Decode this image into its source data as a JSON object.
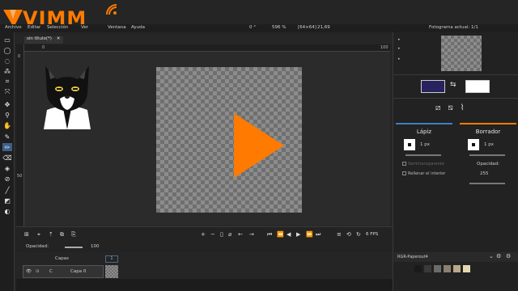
{
  "logo": {
    "text": "VIMM",
    "brand_color": "#ff7a00"
  },
  "menu": {
    "items": [
      "Archivo",
      "Editar",
      "Selección",
      "Ver",
      "Ventana",
      "Ayuda"
    ]
  },
  "status": {
    "rotation": "0 °",
    "zoom": "596 %",
    "canvas_size": "[64×64]",
    "cursor": "21,69"
  },
  "frames_header": {
    "label": "Fotograma actual:",
    "value": "1/1"
  },
  "tab": {
    "title": "sin título(*)",
    "close": "✕"
  },
  "ruler": {
    "top_start": "0",
    "top_end": "100",
    "left_mark": "0",
    "left_mid": "50"
  },
  "timeline": {
    "fps": "6 FPS"
  },
  "layer_opacity": {
    "label": "Opacidad:",
    "value": "100"
  },
  "layers": {
    "header": "Capas",
    "frame_number": "1",
    "layer_name": "Capa 0",
    "layer_prefix": "C"
  },
  "colors": {
    "primary": "#28235e",
    "secondary": "#ffffff"
  },
  "pencil": {
    "title": "Lápiz",
    "size": "1 px",
    "pixel_perfect": "Semitransparente",
    "fill_inside": "Rellenar el interior",
    "accent": "#3d7fc4"
  },
  "eraser": {
    "title": "Borrador",
    "size": "1 px",
    "opacity_label": "Opacidad:",
    "opacity_value": "255",
    "accent": "#ff7a00"
  },
  "palette": {
    "name": "RGR-Paperout4",
    "swatches": [
      "#1a1a1a",
      "#3a3a3a",
      "#6b6b6b",
      "#8a8070",
      "#b8a98a",
      "#e4d8b4"
    ]
  }
}
